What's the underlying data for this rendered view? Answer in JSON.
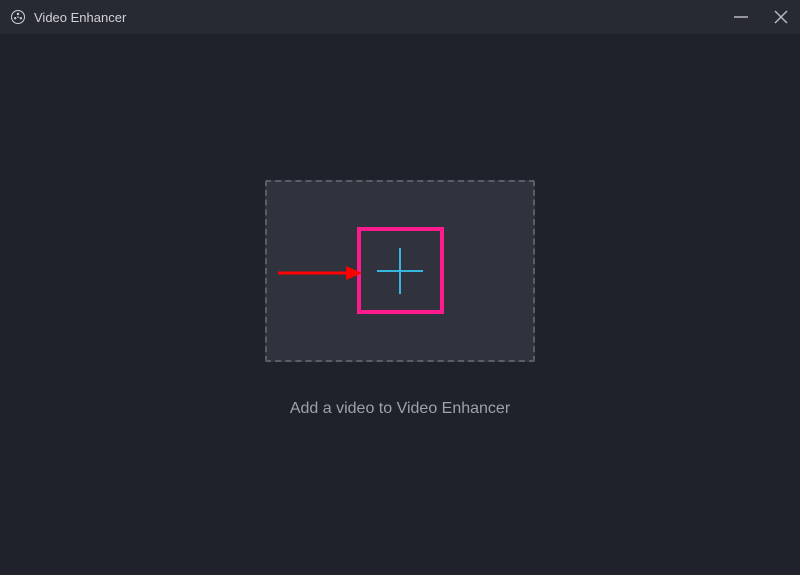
{
  "titlebar": {
    "app_title": "Video Enhancer"
  },
  "main": {
    "instruction_text": "Add a video to Video Enhancer"
  },
  "colors": {
    "accent_plus": "#39b6e0",
    "highlight_magenta": "#ff1b8d",
    "arrow_red": "#ff0000"
  }
}
